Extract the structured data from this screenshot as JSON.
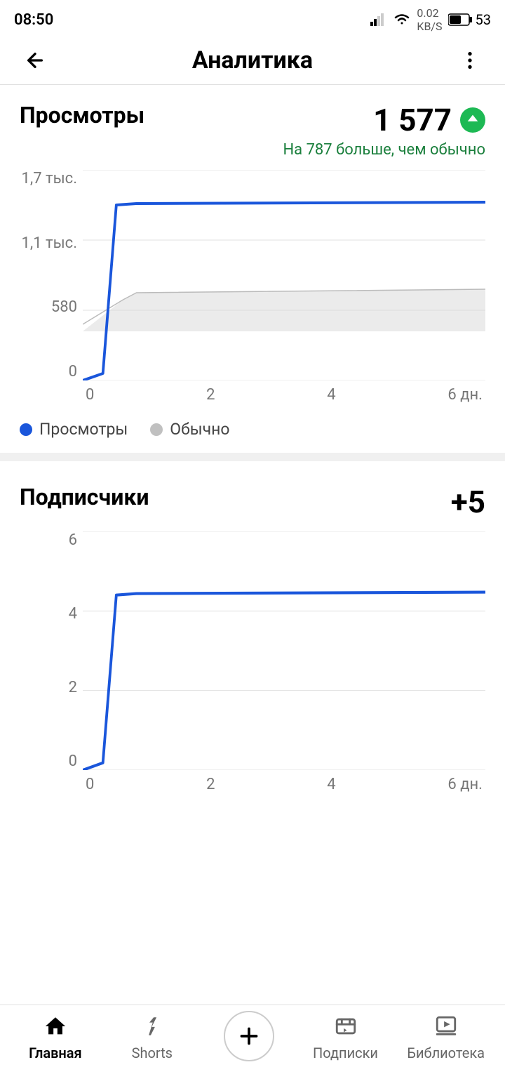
{
  "statusBar": {
    "time": "08:50",
    "battery": "53"
  },
  "appBar": {
    "title": "Аналитика",
    "backLabel": "back",
    "moreLabel": "more"
  },
  "views": {
    "title": "Просмотры",
    "value": "1 577",
    "subtitle": "На 787 больше, чем обычно",
    "chart": {
      "yLabels": [
        "1,7 тыс.",
        "1,1 тыс.",
        "580",
        "0"
      ],
      "xLabels": [
        "0",
        "2",
        "4",
        "6 дн."
      ],
      "legend": [
        {
          "label": "Просмотры",
          "color": "#1a56db"
        },
        {
          "label": "Обычно",
          "color": "#c0c0c0"
        }
      ]
    }
  },
  "subscribers": {
    "title": "Подписчики",
    "value": "+5",
    "chart": {
      "yLabels": [
        "6",
        "4",
        "2",
        "0"
      ],
      "xLabels": [
        "0",
        "2",
        "4",
        "6 дн."
      ]
    }
  },
  "bottomNav": {
    "items": [
      {
        "label": "Главная",
        "icon": "home",
        "active": true
      },
      {
        "label": "Shorts",
        "icon": "shorts",
        "active": false
      },
      {
        "label": "",
        "icon": "add",
        "active": false
      },
      {
        "label": "Подписки",
        "icon": "subscriptions",
        "active": false
      },
      {
        "label": "Библиотека",
        "icon": "library",
        "active": false
      }
    ]
  }
}
